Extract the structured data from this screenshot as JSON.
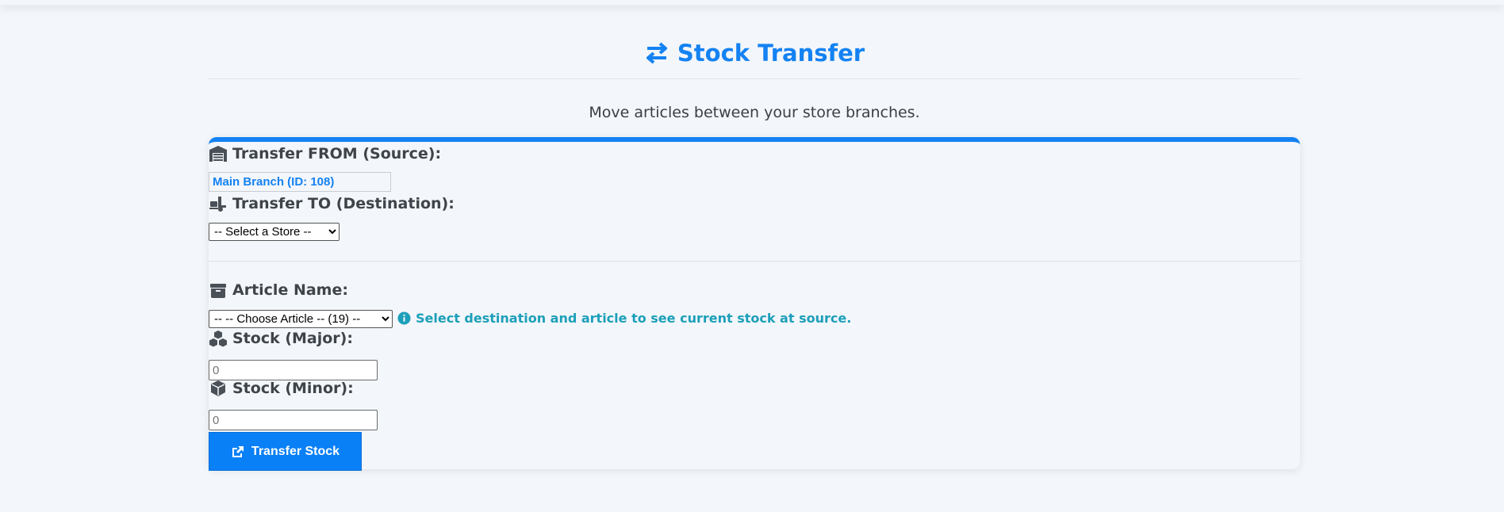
{
  "page": {
    "title": "Stock Transfer",
    "subtitle": "Move articles between your store branches."
  },
  "form": {
    "source_label": "Transfer FROM (Source):",
    "source_value": "Main Branch (ID: 108)",
    "destination_label": "Transfer TO (Destination):",
    "destination_selected": "-- Select a Store --",
    "article_label": "Article Name:",
    "article_selected": "-- -- Choose Article -- (19) --",
    "article_hint": "Select destination and article to see current stock at source.",
    "stock_major_label": "Stock (Major):",
    "stock_major_placeholder": "0",
    "stock_minor_label": "Stock (Minor):",
    "stock_minor_placeholder": "0",
    "submit_label": "Transfer Stock"
  },
  "colors": {
    "accent": "#1482f2",
    "hint": "#1c9fba",
    "button": "#0a80f7"
  },
  "icons": {
    "title": "exchange-arrows-icon",
    "source": "warehouse-icon",
    "destination": "truck-loading-icon",
    "article": "box-icon",
    "stock_major": "cubes-icon",
    "stock_minor": "cube-icon",
    "hint": "info-circle-icon",
    "submit": "share-square-icon"
  }
}
